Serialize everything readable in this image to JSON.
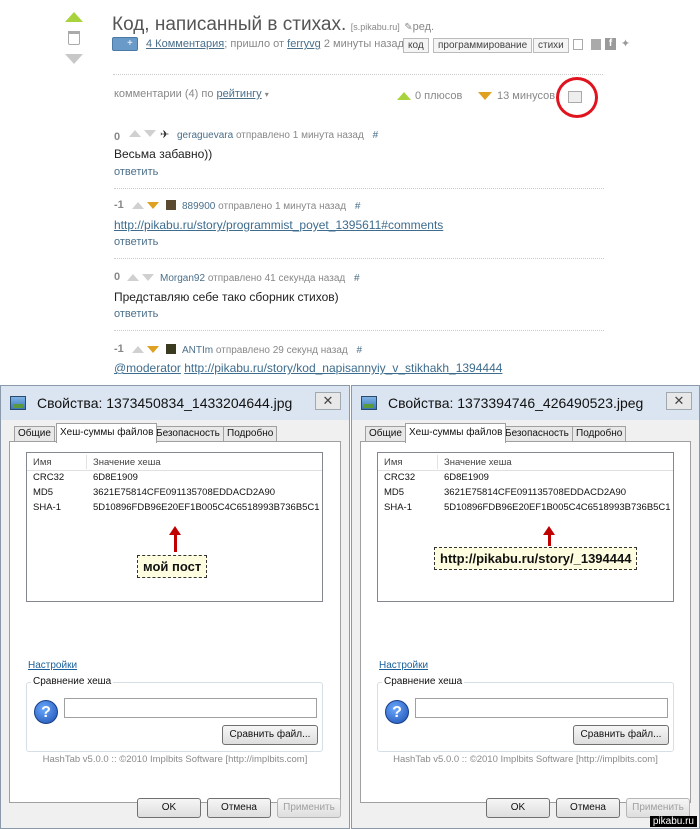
{
  "post": {
    "title": "Код, написанный в стихах.",
    "source": "[s.pikabu.ru]",
    "edit_label": "ред.",
    "add_label": "+",
    "comments_link": "4 Комментария",
    "came_from": "; пришло от",
    "author": "ferryvg",
    "time": "2 минуты назад",
    "tags": [
      "код",
      "программирование",
      "стихи"
    ],
    "comments_sort_prefix": "комментарии (4) по",
    "comments_sort_value": "рейтингу",
    "plus_count": "0 плюсов",
    "minus_count": "13 минусов"
  },
  "comments": [
    {
      "rating": "0",
      "user": "geraguevara",
      "meta": "отправлено 1 минута назад",
      "hash": "#",
      "text": "Весьма забавно))",
      "reply": "ответить"
    },
    {
      "rating": "-1",
      "user": "889900",
      "meta": "отправлено 1 минута назад",
      "hash": "#",
      "link": "http://pikabu.ru/story/programmist_poyet_1395611#comments",
      "reply": "ответить"
    },
    {
      "rating": "0",
      "user": "Morgan92",
      "meta": "отправлено 41 секунда назад",
      "hash": "#",
      "text": "Представляю себе тако сборник стихов)",
      "reply": "ответить"
    },
    {
      "rating": "-1",
      "user": "ANTIm",
      "meta": "отправлено 29 секунд назад",
      "hash": "#",
      "mention": "@moderator",
      "link": "http://pikabu.ru/story/kod_napisannyiy_v_stikhakh_1394444"
    }
  ],
  "dialogs": [
    {
      "title": "Свойства: 1373450834_1433204644.jpg",
      "annotation": "мой пост"
    },
    {
      "title": "Свойства: 1373394746_426490523.jpeg",
      "annotation": "http://pikabu.ru/story/_1394444"
    }
  ],
  "dialog_common": {
    "close": "✕",
    "tabs": [
      "Общие",
      "Хеш-суммы файлов",
      "Безопасность",
      "Подробно"
    ],
    "col_name": "Имя",
    "col_value": "Значение хеша",
    "hashes": [
      {
        "name": "CRC32",
        "value": "6D8E1909"
      },
      {
        "name": "MD5",
        "value": "3621E75814CFE091135708EDDACD2A90"
      },
      {
        "name": "SHA-1",
        "value": "5D10896FDB96E20EF1B005C4C6518993B736B5C1"
      }
    ],
    "settings": "Настройки",
    "compare_label": "Сравнение хеша",
    "compare_button": "Сравнить файл...",
    "footer": "HashTab v5.0.0 :: ©2010 Implbits Software [http://implbits.com]",
    "ok": "OK",
    "cancel": "Отмена",
    "apply": "Применить"
  },
  "watermark": "pikabu.ru",
  "colors": {
    "accent_green": "#a8d33c",
    "minus_orange": "#e0a020",
    "annotation_red": "#c00000"
  }
}
